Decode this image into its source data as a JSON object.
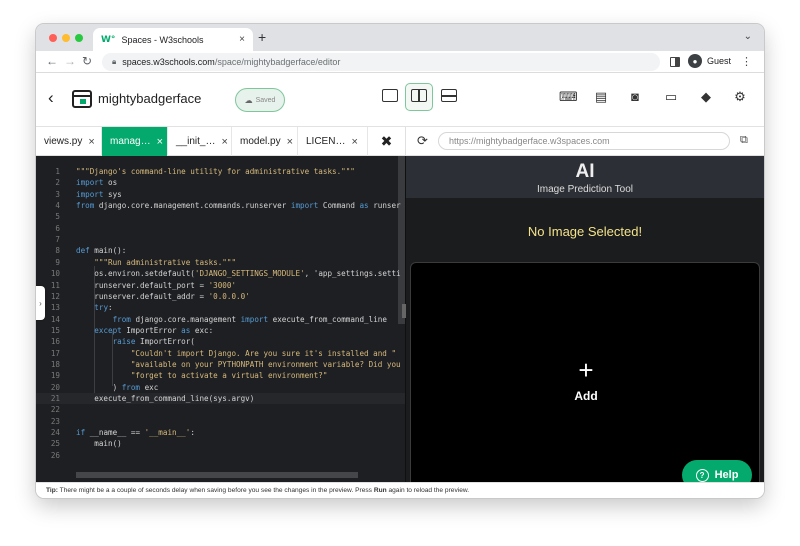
{
  "browser": {
    "tab_title": "Spaces - W3schools",
    "tab_close": "×",
    "new_tab": "+",
    "tab_menu": "⌄",
    "url_host": "spaces.w3schools.com",
    "url_path": "/space/mightybadgerface/editor",
    "profile_name": "Guest",
    "menu": "⋮"
  },
  "header": {
    "back": "‹",
    "space_name": "mightybadgerface",
    "saved_label": "Saved"
  },
  "file_tabs": [
    {
      "label": "views.py",
      "close": "×",
      "active": false
    },
    {
      "label": "manag…",
      "close": "×",
      "active": true
    },
    {
      "label": "__init_…",
      "close": "×",
      "active": false
    },
    {
      "label": "model.py",
      "close": "×",
      "active": false
    },
    {
      "label": "LICEN…",
      "close": "×",
      "active": false
    }
  ],
  "preview_url_placeholder": "https://mightybadgerface.w3spaces.com",
  "editor": {
    "lines": [
      {
        "n": "1",
        "t": "\"\"\"Django's command-line utility for administrative tasks.\"\"\""
      },
      {
        "n": "2",
        "t": "import os"
      },
      {
        "n": "3",
        "t": "import sys"
      },
      {
        "n": "4",
        "t": "from django.core.management.commands.runserver import Command as runser"
      },
      {
        "n": "5",
        "t": ""
      },
      {
        "n": "6",
        "t": ""
      },
      {
        "n": "7",
        "t": ""
      },
      {
        "n": "8",
        "t": "def main():"
      },
      {
        "n": "9",
        "t": "    \"\"\"Run administrative tasks.\"\"\""
      },
      {
        "n": "10",
        "t": "    os.environ.setdefault('DJANGO_SETTINGS_MODULE', 'app_settings.setti"
      },
      {
        "n": "11",
        "t": "    runserver.default_port = '3000'"
      },
      {
        "n": "12",
        "t": "    runserver.default_addr = '0.0.0.0'"
      },
      {
        "n": "13",
        "t": "    try:"
      },
      {
        "n": "14",
        "t": "        from django.core.management import execute_from_command_line"
      },
      {
        "n": "15",
        "t": "    except ImportError as exc:"
      },
      {
        "n": "16",
        "t": "        raise ImportError("
      },
      {
        "n": "17",
        "t": "            \"Couldn't import Django. Are you sure it's installed and \""
      },
      {
        "n": "18",
        "t": "            \"available on your PYTHONPATH environment variable? Did you"
      },
      {
        "n": "19",
        "t": "            \"forget to activate a virtual environment?\""
      },
      {
        "n": "20",
        "t": "        ) from exc"
      },
      {
        "n": "21",
        "t": "    execute_from_command_line(sys.argv)"
      },
      {
        "n": "22",
        "t": ""
      },
      {
        "n": "23",
        "t": ""
      },
      {
        "n": "24",
        "t": "if __name__ == '__main__':"
      },
      {
        "n": "25",
        "t": "    main()"
      },
      {
        "n": "26",
        "t": ""
      }
    ]
  },
  "preview": {
    "title": "AI",
    "subtitle": "Image Prediction Tool",
    "no_image": "No Image Selected!",
    "plus": "+",
    "add_label": "Add"
  },
  "help_label": "Help",
  "footer": {
    "tip_label": "Tip:",
    "tip_part1": " There might be a a couple of seconds delay when saving before you see the changes in the preview. Press ",
    "run_word": "Run",
    "tip_part2": " again to reload the preview."
  },
  "colors": {
    "accent": "#04aa6d",
    "editor_bg": "#1e1f22",
    "preview_bg": "#1b1c1e"
  }
}
